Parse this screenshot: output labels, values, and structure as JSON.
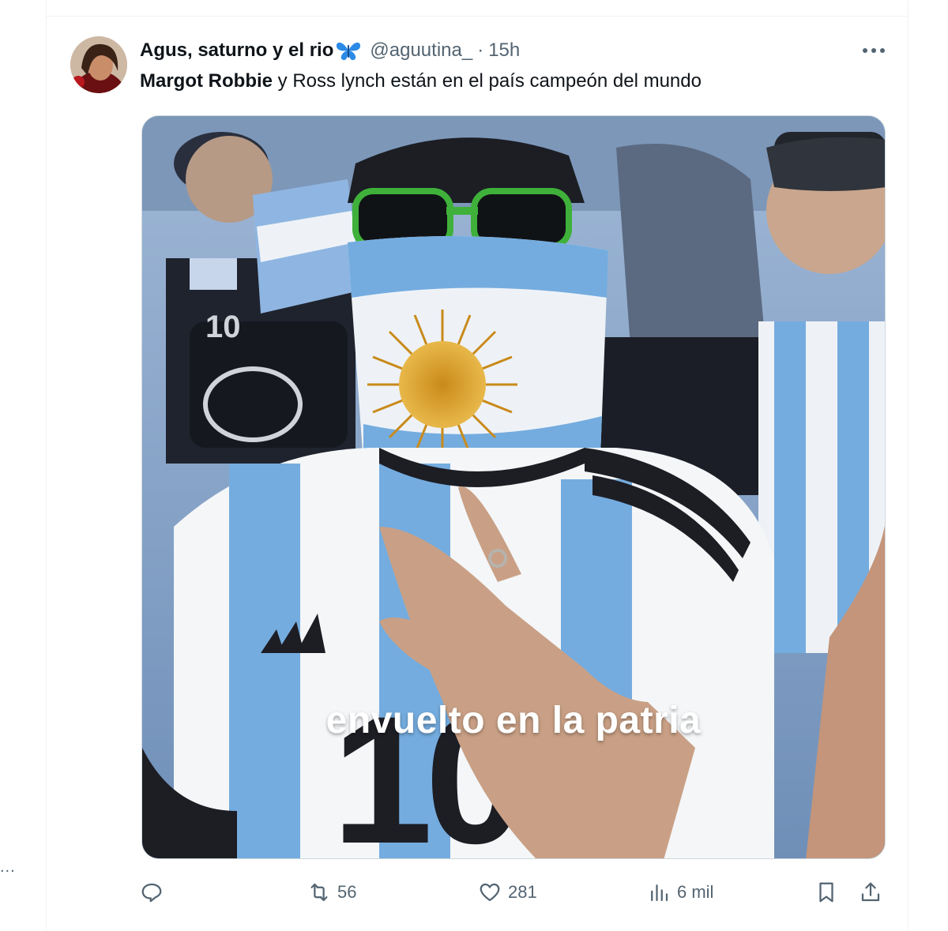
{
  "left_edge": {
    "dots": "..."
  },
  "tweet": {
    "author": {
      "display_name": "Agus, saturno y el rio",
      "emoji_icon": "butterfly-emoji",
      "handle": "@aguutina_",
      "separator": "·",
      "time": "15h"
    },
    "more_icon": "more-horizontal-icon",
    "text": {
      "mention": "Margot Robbie",
      "rest": " y Ross lynch están en el país campeón del mundo"
    },
    "media": {
      "caption": "envuelto en la patria",
      "colors": {
        "sky": "#74acdf",
        "white": "#f4f6f8",
        "sun": "#d9a126",
        "shirt_black": "#1d1d24"
      }
    },
    "actions": {
      "reply": {
        "icon": "reply-icon",
        "count": ""
      },
      "retweet": {
        "icon": "retweet-icon",
        "count": "56"
      },
      "like": {
        "icon": "heart-icon",
        "count": "281"
      },
      "views": {
        "icon": "views-chart-icon",
        "count": "6 mil"
      },
      "bookmark": {
        "icon": "bookmark-icon"
      },
      "share": {
        "icon": "share-icon"
      }
    },
    "accent_color": "#536471"
  }
}
